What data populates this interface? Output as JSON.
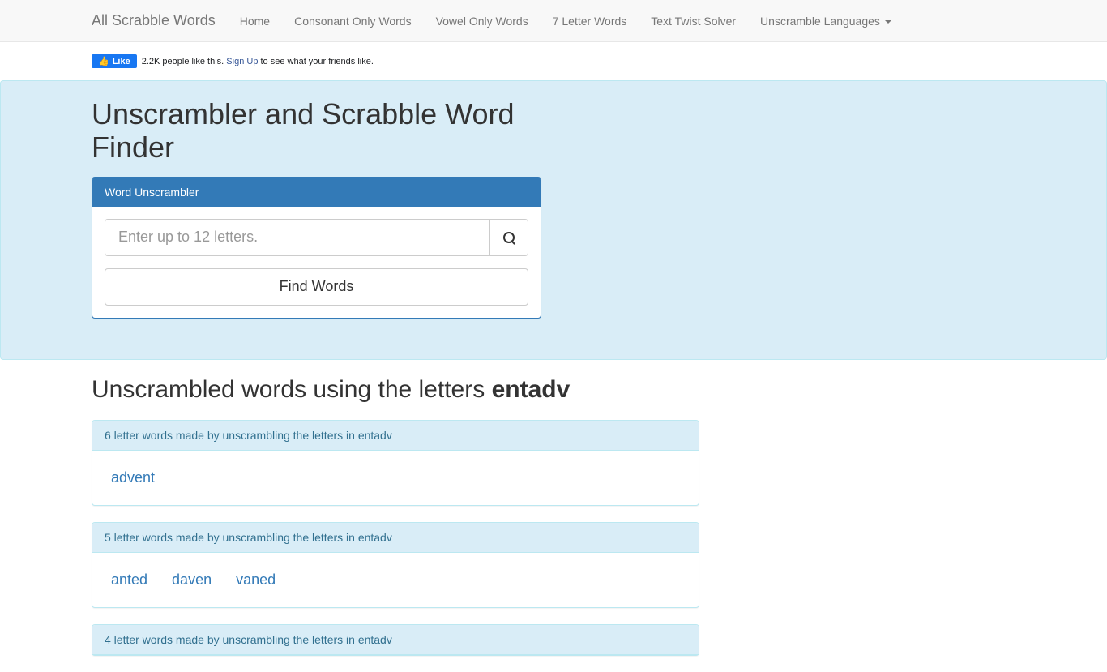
{
  "navbar": {
    "brand": "All Scrabble Words",
    "items": [
      {
        "label": "Home"
      },
      {
        "label": "Consonant Only Words"
      },
      {
        "label": "Vowel Only Words"
      },
      {
        "label": "7 Letter Words"
      },
      {
        "label": "Text Twist Solver"
      },
      {
        "label": "Unscramble Languages",
        "dropdown": true
      }
    ]
  },
  "fb": {
    "like_label": "Like",
    "text_before": "2.2K people like this. ",
    "signup": "Sign Up",
    "text_after": " to see what your friends like."
  },
  "hero": {
    "title": "Unscrambler and Scrabble Word Finder",
    "panel_title": "Word Unscrambler",
    "placeholder": "Enter up to 12 letters.",
    "button": "Find Words"
  },
  "results": {
    "heading_prefix": "Unscrambled words using the letters ",
    "letters": "entadv",
    "groups": [
      {
        "title": "6 letter words made by unscrambling the letters in entadv",
        "words": [
          "advent"
        ]
      },
      {
        "title": "5 letter words made by unscrambling the letters in entadv",
        "words": [
          "anted",
          "daven",
          "vaned"
        ]
      },
      {
        "title": "4 letter words made by unscrambling the letters in entadv",
        "words": []
      }
    ]
  }
}
